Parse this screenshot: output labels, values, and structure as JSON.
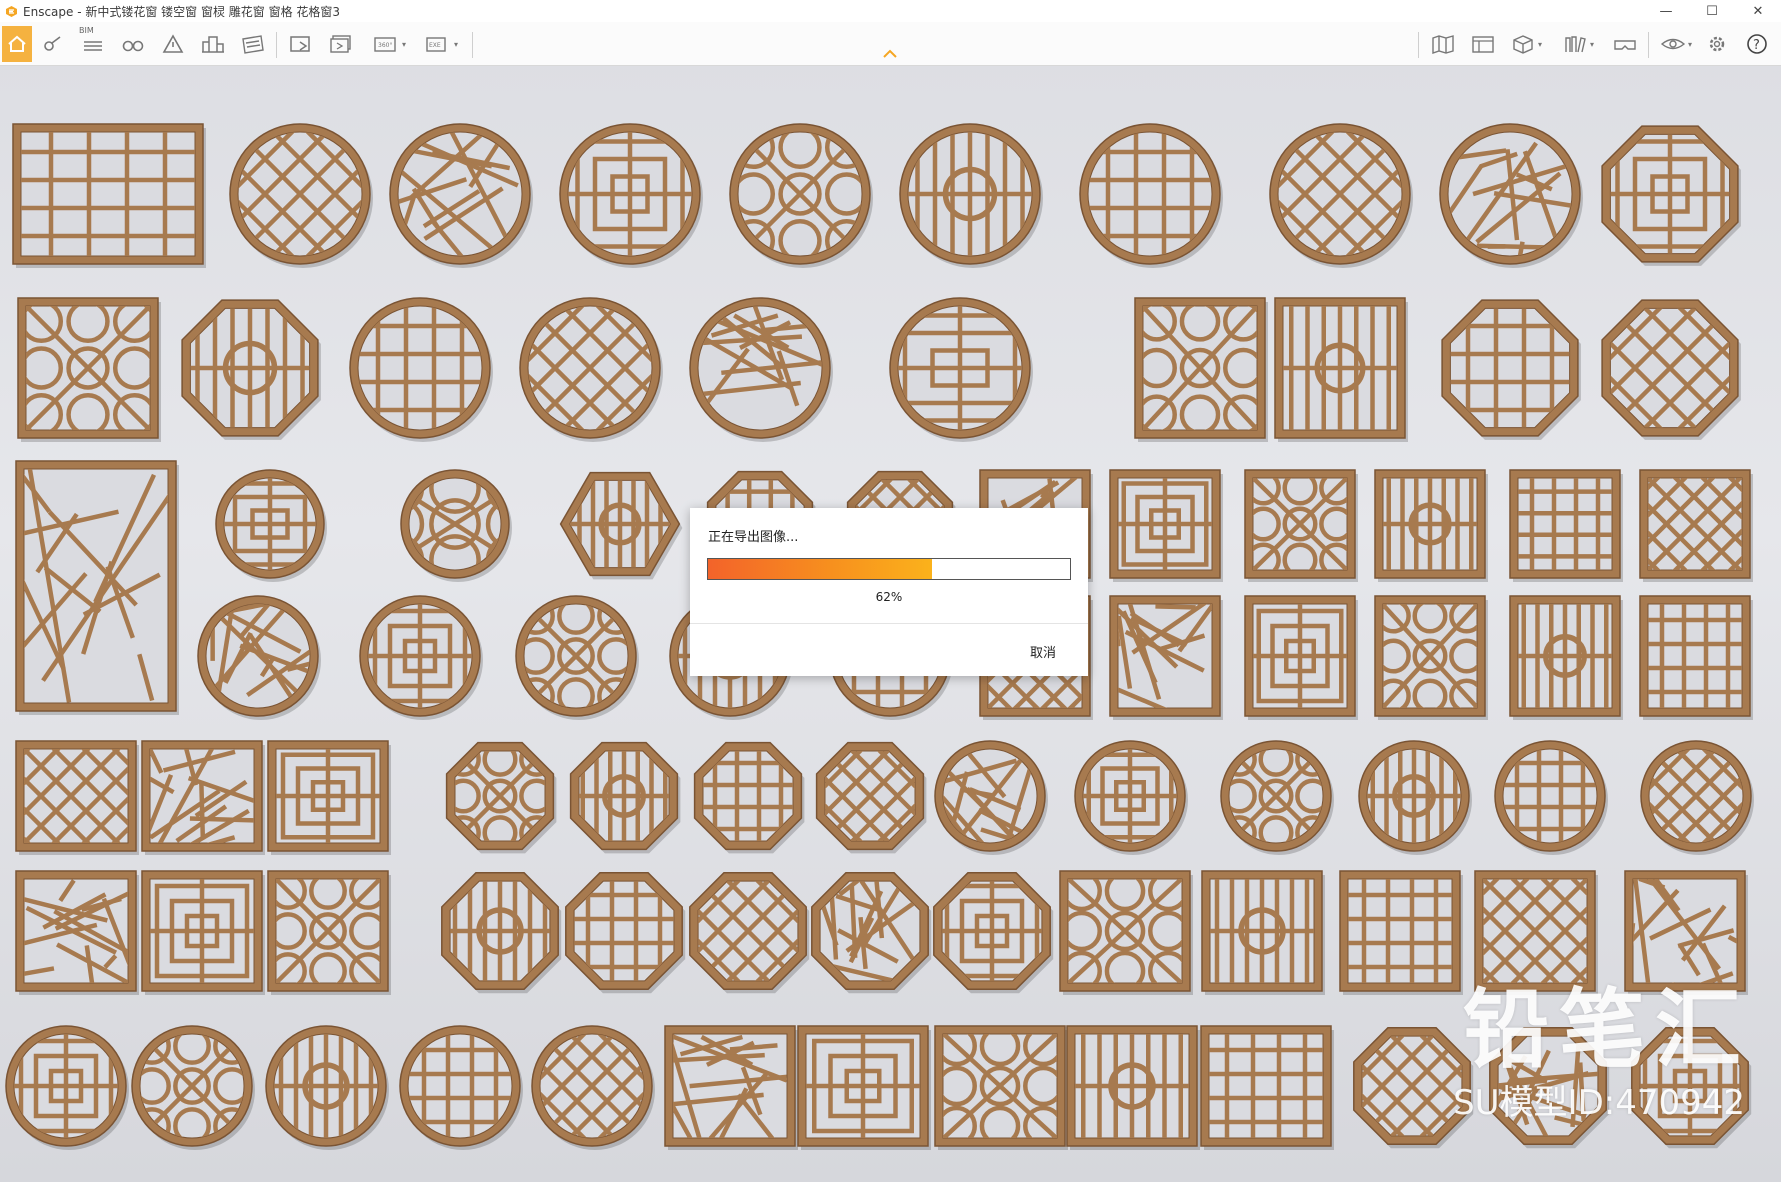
{
  "window": {
    "title": "Enscape - 新中式镂花窗 镂空窗 窗棂 雕花窗 窗格 花格窗3",
    "controls": {
      "minimize": "—",
      "maximize": "☐",
      "close": "✕"
    }
  },
  "toolbar": {
    "bim_label": "BIM",
    "buttons": [
      "home-icon",
      "map-pin-icon",
      "bim-list-icon",
      "binoculars-icon",
      "alert-triangle-icon",
      "buildings-icon",
      "blueprint-icon",
      "screenshot-export-icon",
      "batch-export-icon",
      "panorama-360-icon",
      "exe-export-icon",
      "map-icon",
      "layout-panels-icon",
      "box-3d-icon",
      "books-icon",
      "vr-headset-icon",
      "eye-settings-icon",
      "gear-icon",
      "help-icon"
    ],
    "panorama_label": "360°",
    "exe_label": "EXE",
    "accent_color": "#f5b240"
  },
  "viewport": {
    "wood_color": "#a77a4f",
    "background": "#e0e1e5"
  },
  "export_dialog": {
    "title": "正在导出图像...",
    "progress": 0.62,
    "progress_text": "62%",
    "cancel_label": "取消"
  },
  "watermark": {
    "text": "铅笔汇",
    "id_text": "SU模型ID:470942"
  }
}
